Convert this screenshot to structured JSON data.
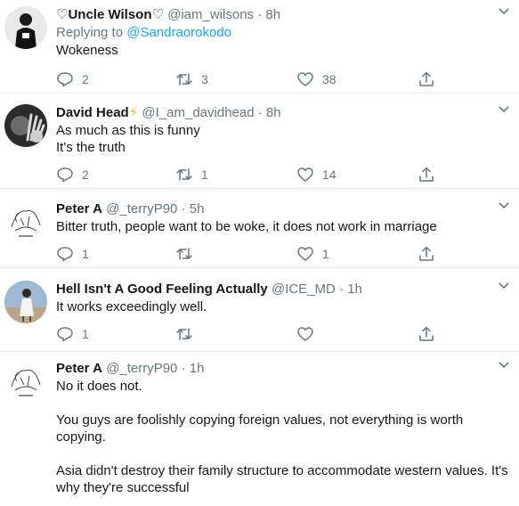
{
  "tweets": [
    {
      "name": "♡Uncle Wilson♡",
      "handle": "@iam_wilsons",
      "time": "8h",
      "reply_prefix": "Replying to",
      "reply_mention": "@Sandraorokodo",
      "lines": [
        "Wokeness"
      ],
      "replies": "2",
      "retweets": "3",
      "likes": "38"
    },
    {
      "name": "David Head",
      "name_emoji": "⚡",
      "handle": "@I_am_davidhead",
      "time": "8h",
      "lines": [
        "As much as this is funny",
        "It's the truth"
      ],
      "replies": "2",
      "retweets": "1",
      "likes": "14"
    },
    {
      "name": "Peter A",
      "handle": "@_terryP90",
      "time": "5h",
      "lines": [
        "Bitter truth, people want to be woke, it does not work in marriage"
      ],
      "replies": "1",
      "retweets": "",
      "likes": "1"
    },
    {
      "name": "Hell Isn't A Good Feeling Actually",
      "handle": "@ICE_MD",
      "time": "1h",
      "lines": [
        "It works exceedingly well."
      ],
      "replies": "1",
      "retweets": "",
      "likes": ""
    },
    {
      "name": "Peter A",
      "handle": "@_terryP90",
      "time": "1h",
      "paragraphs": [
        "No it does not.",
        "You guys are foolishly copying foreign values, not everything is worth copying.",
        "Asia didn't destroy their family structure to accommodate western values. It's why they're successful"
      ]
    }
  ],
  "separator": "·",
  "colors": {
    "name": "#14171a",
    "meta": "#657786",
    "link": "#1da1f2",
    "divider": "#e6ecf0",
    "lightning": "#ffac33"
  },
  "icons": [
    "reply-icon",
    "retweet-icon",
    "like-icon",
    "share-icon",
    "chevron-down-icon"
  ]
}
